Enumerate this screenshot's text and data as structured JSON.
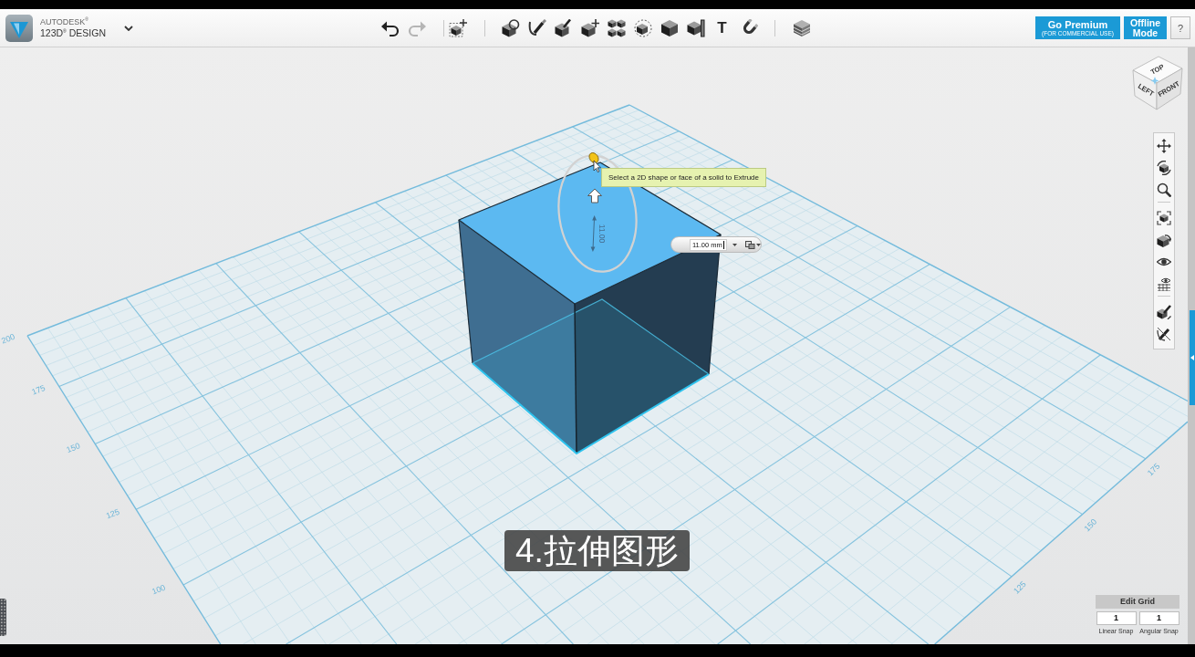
{
  "app_bar": {
    "logo": {
      "brand": "AUTODESK$^{®}$",
      "product": "123D$^{®}$ DESIGN"
    },
    "undo": {
      "disabled": false
    },
    "redo": {
      "disabled": true
    },
    "text_tool": {
      "label": "T"
    },
    "premium_button": {
      "label": "Go Premium",
      "sublabel": "(FOR COMMERCIAL USE)"
    },
    "offline_button": {
      "label": "Offline Mode"
    },
    "help_button": {
      "label": "?"
    }
  },
  "view_cube": {
    "top": "TOP",
    "left": "LEFT",
    "front": "FRONT"
  },
  "viewport": {
    "grid_labels": {
      "left_edge": [
        "200",
        "175",
        "150",
        "125",
        "100"
      ],
      "right_edge": [
        "175",
        "150",
        "125"
      ]
    },
    "tooltip": "Select a 2D shape or face of a solid to Extrude",
    "dimension_label": "11.00",
    "dimension_input": {
      "value": "11.00 mm"
    },
    "caption": "4.拉伸图形"
  },
  "edit_grid": {
    "title": "Edit Grid",
    "fields": [
      {
        "label": "Linear Snap",
        "value": "1"
      },
      {
        "label": "Angular Snap",
        "value": "1"
      }
    ]
  }
}
